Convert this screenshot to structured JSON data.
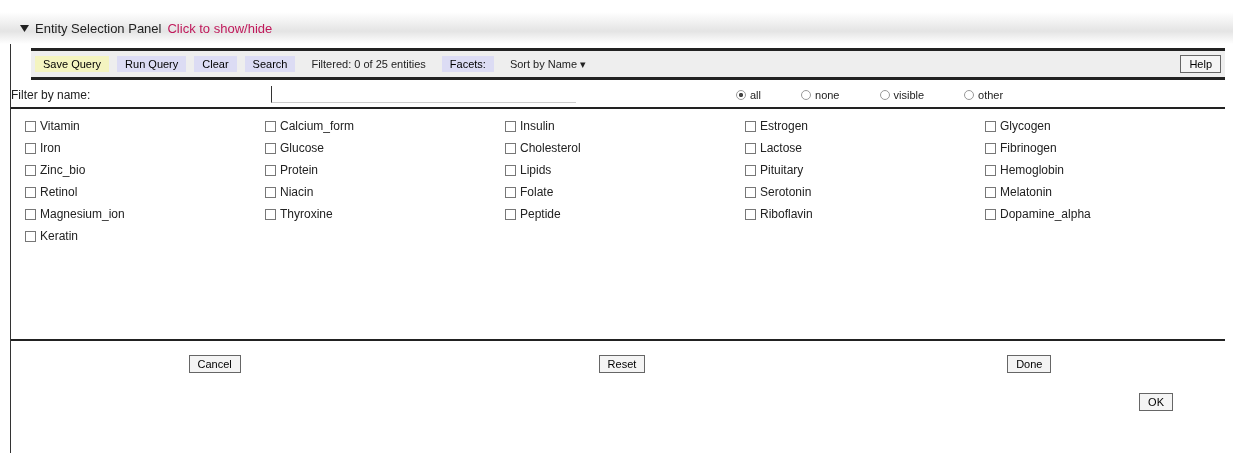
{
  "panel": {
    "title": "Entity Selection Panel",
    "hint": "Click to show/hide",
    "expanded": true
  },
  "toolbar": [
    {
      "label": "Save Query",
      "kind": "yellow"
    },
    {
      "label": "Run Query",
      "kind": "blue"
    },
    {
      "label": "Clear",
      "kind": "blue"
    },
    {
      "label": "Search",
      "kind": "blue"
    },
    {
      "label": "Filtered: 0 of 25 entities",
      "kind": "text"
    },
    {
      "label": "Facets:",
      "kind": "blue"
    },
    {
      "label": "Sort by Name ▾",
      "kind": "text"
    },
    {
      "label": "Help",
      "kind": "button"
    }
  ],
  "filter": {
    "label": "Filter by name:"
  },
  "scope": [
    {
      "label": "all",
      "selected": true
    },
    {
      "label": "none",
      "selected": false
    },
    {
      "label": "visible",
      "selected": false
    },
    {
      "label": "other",
      "selected": false
    }
  ],
  "entities": [
    {
      "label": "Vitamin",
      "checked": false
    },
    {
      "label": "Calcium_form",
      "checked": false
    },
    {
      "label": "Insulin",
      "checked": false
    },
    {
      "label": "Estrogen",
      "checked": false
    },
    {
      "label": "Glycogen",
      "checked": false
    },
    {
      "label": "Iron",
      "checked": false
    },
    {
      "label": "Glucose",
      "checked": false
    },
    {
      "label": "Cholesterol",
      "checked": false
    },
    {
      "label": "Lactose",
      "checked": false
    },
    {
      "label": "Fibrinogen",
      "checked": false
    },
    {
      "label": "Zinc_bio",
      "checked": false
    },
    {
      "label": "Protein",
      "checked": false
    },
    {
      "label": "Lipids",
      "checked": false
    },
    {
      "label": "Pituitary",
      "checked": false
    },
    {
      "label": "Hemoglobin",
      "checked": false
    },
    {
      "label": "Retinol",
      "checked": false
    },
    {
      "label": "Niacin",
      "checked": false
    },
    {
      "label": "Folate",
      "checked": false
    },
    {
      "label": "Serotonin",
      "checked": false
    },
    {
      "label": "Melatonin",
      "checked": false
    },
    {
      "label": "Magnesium_ion",
      "checked": false
    },
    {
      "label": "Thyroxine",
      "checked": false
    },
    {
      "label": "Peptide",
      "checked": false
    },
    {
      "label": "Riboflavin",
      "checked": false
    },
    {
      "label": "Dopamine_alpha",
      "checked": false
    },
    {
      "label": "Keratin",
      "checked": false
    }
  ],
  "actions": [
    "Cancel",
    "Reset",
    "Done"
  ],
  "ok": "OK"
}
